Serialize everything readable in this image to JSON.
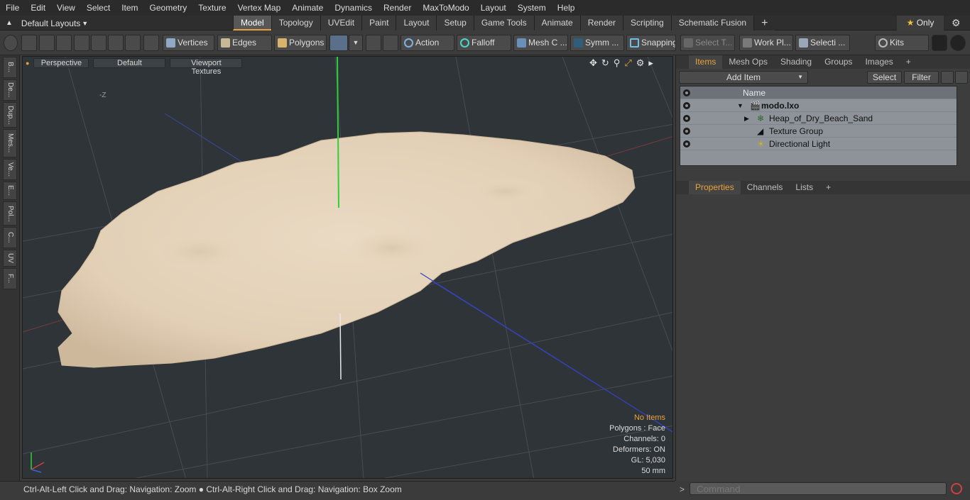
{
  "menu": [
    "File",
    "Edit",
    "View",
    "Select",
    "Item",
    "Geometry",
    "Texture",
    "Vertex Map",
    "Animate",
    "Dynamics",
    "Render",
    "MaxToModo",
    "Layout",
    "System",
    "Help"
  ],
  "layout_selector": "Default Layouts",
  "mode_tabs": [
    "Model",
    "Topology",
    "UVEdit",
    "Paint",
    "Layout",
    "Setup",
    "Game Tools",
    "Animate",
    "Render",
    "Scripting",
    "Schematic Fusion"
  ],
  "active_tab": "Model",
  "only_label": "Only",
  "toolbar": {
    "vertices": "Vertices",
    "edges": "Edges",
    "polygons": "Polygons",
    "action": "Action",
    "falloff": "Falloff",
    "mesh_c": "Mesh C ...",
    "symm": "Symm ...",
    "snapping": "Snapping",
    "select_t": "Select T...",
    "work_pl": "Work Pl...",
    "selecti": "Selecti ...",
    "kits": "Kits"
  },
  "left_tabs": [
    "B...",
    "De...",
    "Dup...",
    "Mes...",
    "Ve...",
    "E...",
    "Pol...",
    "C...",
    "UV",
    "F..."
  ],
  "viewport": {
    "view_mode": "Perspective",
    "shading": "Default",
    "textures": "Viewport Textures",
    "axis_label": "-Z",
    "info": {
      "items": "No Items",
      "polygons": "Polygons : Face",
      "channels": "Channels: 0",
      "deformers": "Deformers: ON",
      "gl": "GL: 5,030",
      "mm": "50 mm"
    },
    "item_color": "#e8a23b"
  },
  "status": "Ctrl-Alt-Left Click and Drag: Navigation: Zoom ● Ctrl-Alt-Right Click and Drag: Navigation: Box Zoom",
  "items_panel": {
    "tabs": [
      "Items",
      "Mesh Ops",
      "Shading",
      "Groups",
      "Images"
    ],
    "active_tab": "Items",
    "add_item": "Add Item",
    "select": "Select",
    "filter": "Filter",
    "name_col": "Name",
    "rows": [
      {
        "name": "modo.lxo",
        "bold": true
      },
      {
        "name": "Heap_of_Dry_Beach_Sand",
        "bold": false
      },
      {
        "name": "Texture Group",
        "bold": false
      },
      {
        "name": "Directional Light",
        "bold": false
      }
    ]
  },
  "properties_panel": {
    "tabs": [
      "Properties",
      "Channels",
      "Lists"
    ],
    "active_tab": "Properties"
  },
  "command_placeholder": "Command",
  "colors": {
    "accent": "#e8a23b",
    "sand": "#e6d4bc"
  }
}
